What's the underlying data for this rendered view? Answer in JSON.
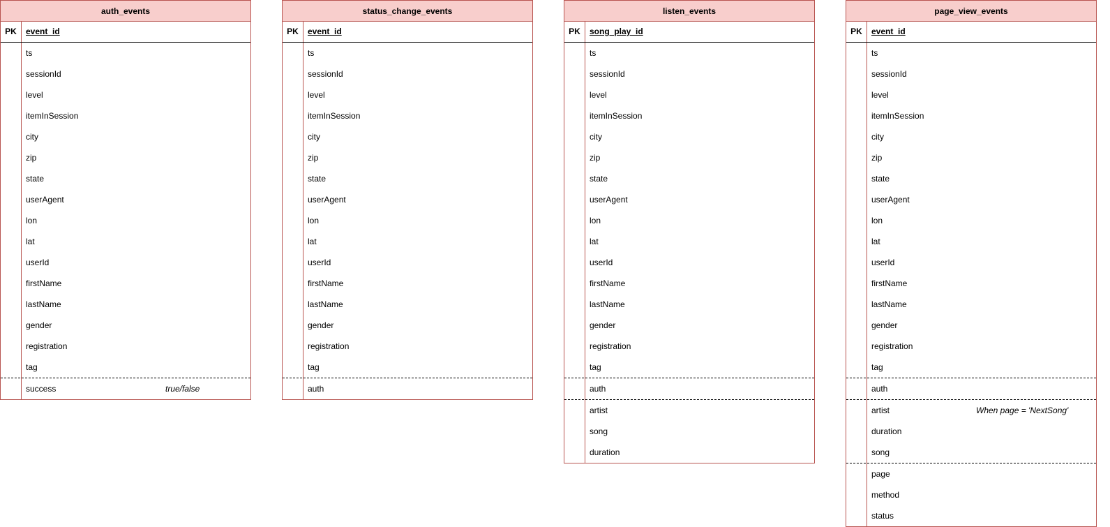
{
  "tables": [
    {
      "name": "auth_events",
      "pk_label": "PK",
      "pk": "event_id",
      "groups": [
        {
          "fields": [
            "ts",
            "sessionId",
            "level",
            "itemInSession",
            "city",
            "zip",
            "state",
            "userAgent",
            "lon",
            "lat",
            "userId",
            "firstName",
            "lastName",
            "gender",
            "registration",
            "tag"
          ]
        },
        {
          "fields": [
            "success"
          ],
          "note": "true/false"
        }
      ]
    },
    {
      "name": "status_change_events",
      "pk_label": "PK",
      "pk": "event_id",
      "groups": [
        {
          "fields": [
            "ts",
            "sessionId",
            "level",
            "itemInSession",
            "city",
            "zip",
            "state",
            "userAgent",
            "lon",
            "lat",
            "userId",
            "firstName",
            "lastName",
            "gender",
            "registration",
            "tag"
          ]
        },
        {
          "fields": [
            "auth"
          ]
        }
      ]
    },
    {
      "name": "listen_events",
      "pk_label": "PK",
      "pk": "song_play_id",
      "groups": [
        {
          "fields": [
            "ts",
            "sessionId",
            "level",
            "itemInSession",
            "city",
            "zip",
            "state",
            "userAgent",
            "lon",
            "lat",
            "userId",
            "firstName",
            "lastName",
            "gender",
            "registration",
            "tag"
          ]
        },
        {
          "fields": [
            "auth"
          ]
        },
        {
          "fields": [
            "artist",
            "song",
            "duration"
          ]
        }
      ]
    },
    {
      "name": "page_view_events",
      "pk_label": "PK",
      "pk": "event_id",
      "groups": [
        {
          "fields": [
            "ts",
            "sessionId",
            "level",
            "itemInSession",
            "city",
            "zip",
            "state",
            "userAgent",
            "lon",
            "lat",
            "userId",
            "firstName",
            "lastName",
            "gender",
            "registration",
            "tag"
          ]
        },
        {
          "fields": [
            "auth"
          ]
        },
        {
          "fields": [
            "artist",
            "duration",
            "song"
          ],
          "note": "When page = 'NextSong'"
        },
        {
          "fields": [
            "page",
            "method",
            "status"
          ]
        }
      ]
    }
  ]
}
